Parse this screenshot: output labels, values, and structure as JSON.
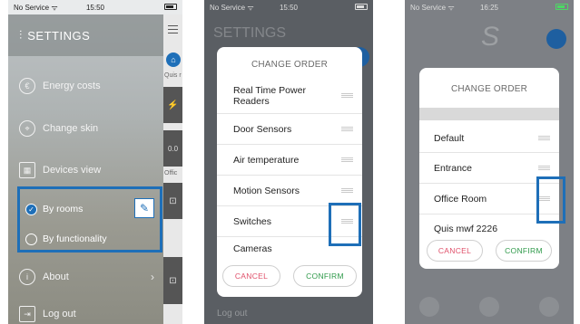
{
  "screen1": {
    "status": {
      "carrier": "No Service ᯤ",
      "time": "15:50"
    },
    "header_title": "SETTINGS",
    "menu": [
      {
        "icon": "energy-icon",
        "glyph": "€",
        "label": "Energy costs"
      },
      {
        "icon": "skin-icon",
        "glyph": "⌖",
        "label": "Change skin"
      },
      {
        "icon": "grid-icon",
        "glyph": "▦",
        "label": "Devices view"
      }
    ],
    "devices_view_options": [
      {
        "label": "By rooms",
        "selected": true
      },
      {
        "label": "By functionality",
        "selected": false
      }
    ],
    "edit_glyph": "✎",
    "bottom_menu": [
      {
        "icon": "info-icon",
        "glyph": "i",
        "label": "About"
      },
      {
        "icon": "logout-icon",
        "glyph": "⇥",
        "label": "Log out"
      }
    ],
    "side_labels": {
      "first": "Quis r",
      "second": "Offic"
    },
    "side_values": {
      "a": "⚡",
      "b": "0.0",
      "c": "⊡",
      "d": "⊡"
    }
  },
  "screen2": {
    "status": {
      "carrier": "No Service ᯤ",
      "time": "15:50"
    },
    "bg_title": "SETTINGS",
    "dialog_title": "CHANGE ORDER",
    "items": [
      "Real Time Power Readers",
      "Door Sensors",
      "Air temperature",
      "Motion Sensors",
      "Switches",
      "Cameras"
    ],
    "cancel": "CANCEL",
    "confirm": "CONFIRM",
    "bg_footer": "Log out"
  },
  "screen3": {
    "status": {
      "carrier": "No Service ᯤ",
      "time": "16:25"
    },
    "bg_letter": "S",
    "dialog_title": "CHANGE ORDER",
    "items": [
      "Default",
      "Entrance",
      "Office Room",
      "Quis mwf 2226"
    ],
    "cancel": "CANCEL",
    "confirm": "CONFIRM"
  },
  "colors": {
    "accent": "#1e6fb8",
    "cancel": "#e0506a",
    "confirm": "#2f9a4a"
  }
}
